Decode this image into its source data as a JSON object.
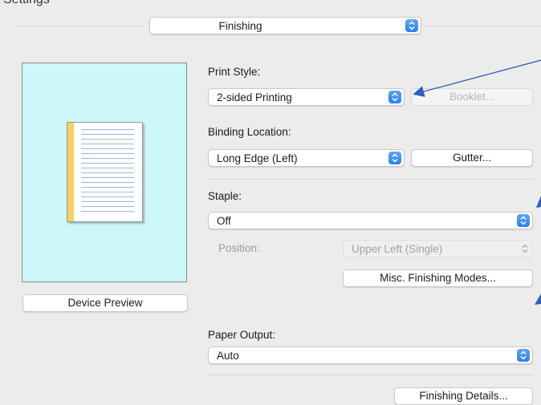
{
  "top_partial_text": "Settings",
  "panel_popup": {
    "label": "Finishing"
  },
  "print_style": {
    "label": "Print Style:",
    "value": "2-sided Printing",
    "booklet_button": "Booklet..."
  },
  "binding_location": {
    "label": "Binding Location:",
    "value": "Long Edge (Left)",
    "gutter_button": "Gutter..."
  },
  "staple": {
    "label": "Staple:",
    "value": "Off",
    "position_label": "Position:",
    "position_value": "Upper Left (Single)",
    "misc_button": "Misc. Finishing Modes..."
  },
  "device_preview_button": "Device Preview",
  "paper_output": {
    "label": "Paper Output:",
    "value": "Auto"
  },
  "finishing_details_button": "Finishing Details...",
  "colors": {
    "accent": "#2d7fe8",
    "preview_bg": "#ccf7fb",
    "binding_strip": "#f7cf63",
    "annotation_arrow": "#2f5fb8"
  },
  "icons": [
    "popup-stepper-icon",
    "document-preview-icon",
    "annotation-arrow-icon"
  ]
}
